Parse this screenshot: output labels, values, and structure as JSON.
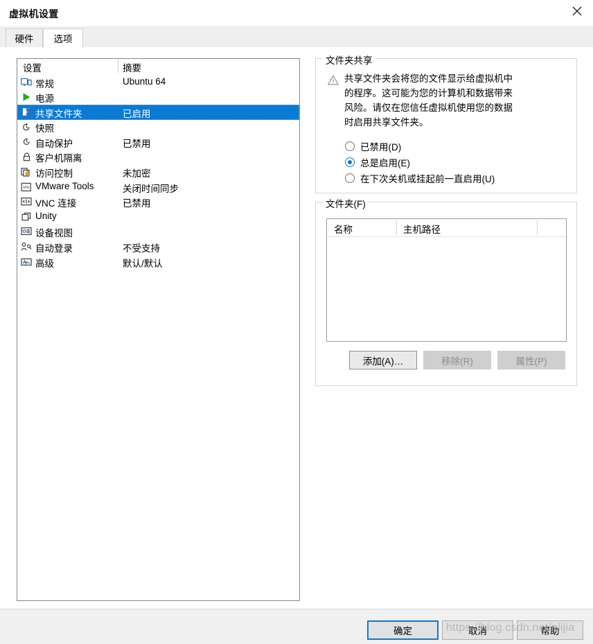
{
  "window": {
    "title": "虚拟机设置",
    "close_icon": "close-icon"
  },
  "tabs": [
    {
      "label": "硬件",
      "active": false
    },
    {
      "label": "选项",
      "active": true
    }
  ],
  "settings_list": {
    "headers": {
      "name": "设置",
      "summary": "摘要"
    },
    "rows": [
      {
        "icon": "monitor-icon",
        "label": "常规",
        "summary": "Ubuntu 64",
        "selected": false
      },
      {
        "icon": "play-icon",
        "label": "电源",
        "summary": "",
        "selected": false
      },
      {
        "icon": "shared-folder-icon",
        "label": "共享文件夹",
        "summary": "已启用",
        "selected": true
      },
      {
        "icon": "snapshot-icon",
        "label": "快照",
        "summary": "",
        "selected": false
      },
      {
        "icon": "autoprotect-icon",
        "label": "自动保护",
        "summary": "已禁用",
        "selected": false
      },
      {
        "icon": "lock-icon",
        "label": "客户机隔离",
        "summary": "",
        "selected": false
      },
      {
        "icon": "access-control-icon",
        "label": "访问控制",
        "summary": "未加密",
        "selected": false
      },
      {
        "icon": "vmware-tools-icon",
        "label": "VMware Tools",
        "summary": "关闭时间同步",
        "selected": false
      },
      {
        "icon": "vnc-icon",
        "label": "VNC 连接",
        "summary": "已禁用",
        "selected": false
      },
      {
        "icon": "unity-icon",
        "label": "Unity",
        "summary": "",
        "selected": false
      },
      {
        "icon": "device-view-icon",
        "label": "设备视图",
        "summary": "",
        "selected": false
      },
      {
        "icon": "auto-login-icon",
        "label": "自动登录",
        "summary": "不受支持",
        "selected": false
      },
      {
        "icon": "advanced-icon",
        "label": "高级",
        "summary": "默认/默认",
        "selected": false
      }
    ]
  },
  "folder_sharing": {
    "title": "文件夹共享",
    "warning_icon": "warning-icon",
    "warning_text": "共享文件夹会将您的文件显示给虚拟机中的程序。这可能为您的计算机和数据带来风险。请仅在您信任虚拟机使用您的数据时启用共享文件夹。",
    "options": [
      {
        "label": "已禁用(D)",
        "checked": false
      },
      {
        "label": "总是启用(E)",
        "checked": true
      },
      {
        "label": "在下次关机或挂起前一直启用(U)",
        "checked": false
      }
    ]
  },
  "folders": {
    "title": "文件夹(F)",
    "columns": [
      "名称",
      "主机路径",
      ""
    ],
    "rows": [],
    "buttons": {
      "add": {
        "label": "添加(A)…",
        "enabled": true
      },
      "remove": {
        "label": "移除(R)",
        "enabled": false
      },
      "property": {
        "label": "属性(P)",
        "enabled": false
      }
    }
  },
  "footer": {
    "ok": "确定",
    "cancel": "取消",
    "help": "帮助",
    "watermark": "https://blog.csdn.net/nlijia"
  },
  "colors": {
    "selection_blue": "#0a7bd4",
    "focus_blue": "#0a7bd4",
    "footer_bg": "#f0f0f0",
    "tab_bg": "#efefef"
  }
}
